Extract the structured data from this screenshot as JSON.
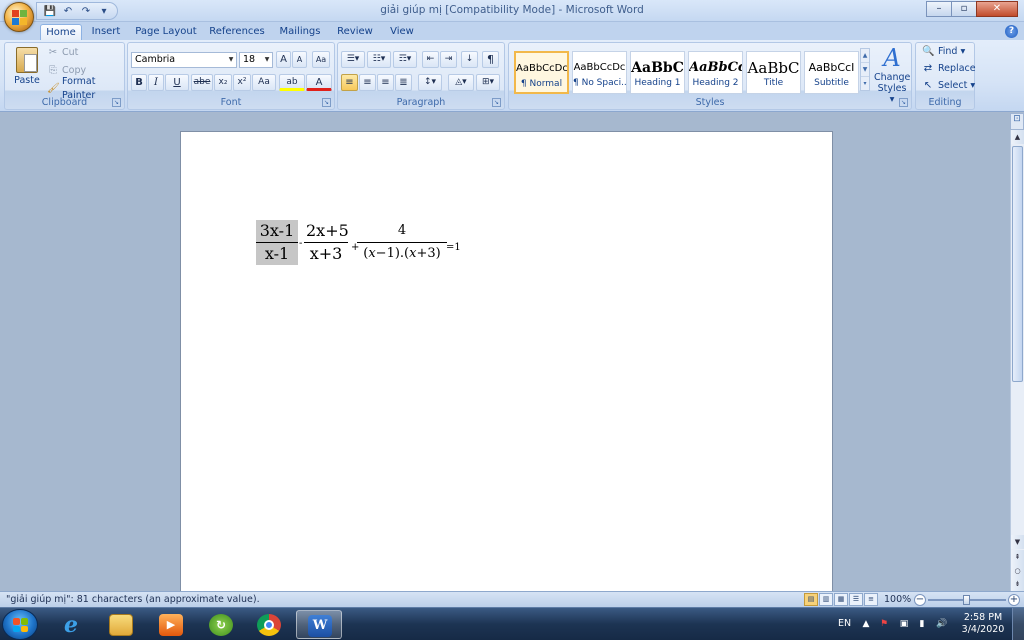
{
  "window": {
    "title": "giải giúp mị [Compatibility Mode] - Microsoft Word",
    "minimize": "–",
    "maximize": "▫",
    "close": "✕"
  },
  "qat": {
    "save_icon": "💾",
    "undo_icon": "↶",
    "redo_icon": "↷",
    "customize_icon": "▾"
  },
  "tabs": [
    {
      "label": "Home"
    },
    {
      "label": "Insert"
    },
    {
      "label": "Page Layout"
    },
    {
      "label": "References"
    },
    {
      "label": "Mailings"
    },
    {
      "label": "Review"
    },
    {
      "label": "View"
    }
  ],
  "ribbon": {
    "clipboard": {
      "label": "Clipboard",
      "paste": "Paste",
      "cut": "Cut",
      "copy": "Copy",
      "format_painter": "Format Painter"
    },
    "font": {
      "label": "Font",
      "family": "Cambria",
      "size": "18",
      "grow": "A",
      "shrink": "A",
      "clear": "Aa",
      "bold": "B",
      "italic": "I",
      "underline": "U",
      "strike": "abe",
      "subscript": "x₂",
      "superscript": "x²",
      "change_case": "Aa",
      "highlight": "ab",
      "font_color": "A"
    },
    "paragraph": {
      "label": "Paragraph",
      "pilcrow": "¶"
    },
    "styles": {
      "label": "Styles",
      "items": [
        {
          "sample": "AaBbCcDc",
          "name": "¶ Normal"
        },
        {
          "sample": "AaBbCcDc",
          "name": "¶ No Spaci..."
        },
        {
          "sample": "AaBbC",
          "name": "Heading 1"
        },
        {
          "sample": "AaBbCc",
          "name": "Heading 2"
        },
        {
          "sample": "AaBbC",
          "name": "Title"
        },
        {
          "sample": "AaBbCcI",
          "name": "Subtitle"
        }
      ],
      "change_styles_line1": "Change",
      "change_styles_line2": "Styles ▾",
      "change_styles_glyph": "A"
    },
    "editing": {
      "label": "Editing",
      "find": "Find ▾",
      "replace": "Replace",
      "select": "Select ▾"
    }
  },
  "document": {
    "equation": {
      "f1_num": "3x-1",
      "f1_den": "x-1",
      "op1": "-",
      "f2_num": "2x+5",
      "f2_den": "x+3",
      "op2": "+",
      "f3_num": "4",
      "f3_den": "(𝑥−1).(𝑥+3)",
      "tail": "=1"
    }
  },
  "status": {
    "text": "\"giải giúp mị\": 81 characters (an approximate value).",
    "zoom": "100%"
  },
  "taskbar": {
    "lang": "EN",
    "time": "2:58 PM",
    "date": "3/4/2020"
  },
  "colors": {
    "ribbon_text": "#15428b",
    "selection": "#c6c6c6",
    "word_blue": "#2b579a"
  }
}
